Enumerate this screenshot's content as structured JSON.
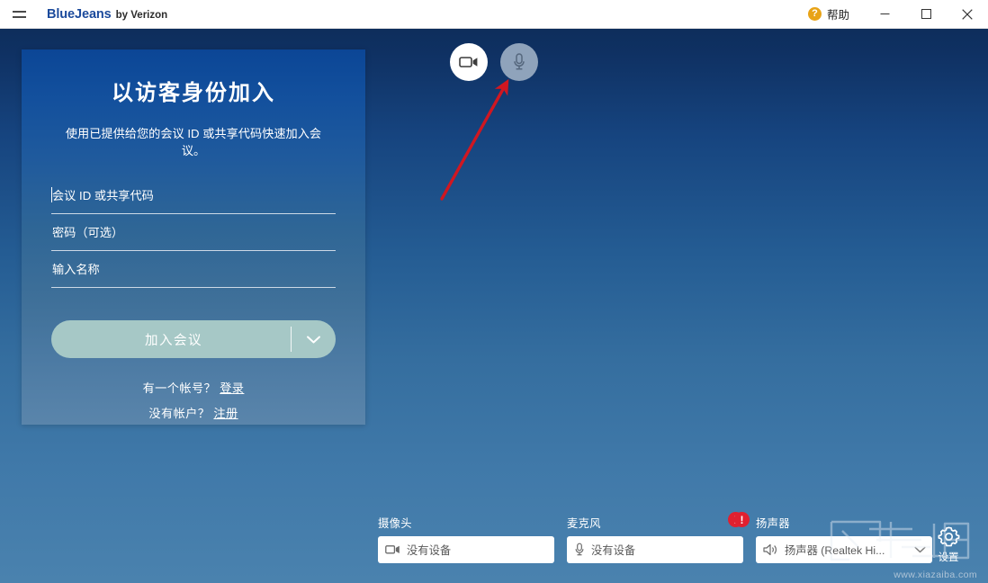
{
  "titlebar": {
    "menu_icon": "hamburger-icon",
    "brand_main": "BlueJeans",
    "brand_sub": "by Verizon",
    "help_icon": "question-mark-icon",
    "help_label": "帮助",
    "minimize_label": "最小化",
    "maximize_label": "最大化",
    "close_label": "关闭"
  },
  "guest_panel": {
    "title": "以访客身份加入",
    "description": "使用已提供给您的会议 ID 或共享代码快速加入会议。",
    "fields": [
      {
        "name": "meeting-id",
        "placeholder": "会议 ID 或共享代码",
        "value": "",
        "focused": true
      },
      {
        "name": "passcode",
        "placeholder": "密码（可选）",
        "value": "",
        "focused": false
      },
      {
        "name": "display-name",
        "placeholder": "输入名称",
        "value": "",
        "focused": false
      }
    ],
    "join_button": {
      "label": "加入会议",
      "color": "#a6c8c6",
      "text_color": "#ffffff",
      "dropdown_icon": "chevron-down-icon"
    },
    "have_account_text": "有一个帐号？",
    "sign_in_link": "登录",
    "no_account_text": "没有帐户？",
    "sign_up_link": "注册"
  },
  "av_toggles": [
    {
      "name": "camera-toggle",
      "icon": "video-camera-icon",
      "state": "on",
      "circle_color": "#ffffff",
      "icon_color": "#3c3c3c"
    },
    {
      "name": "microphone-toggle",
      "icon": "microphone-icon",
      "state": "off",
      "circle_color": "#8fa3bb",
      "icon_color": "#4e5f73"
    }
  ],
  "annotation": {
    "type": "arrow",
    "color": "#d01721",
    "points_at": "microphone-toggle"
  },
  "device_bar": [
    {
      "name": "camera",
      "label": "摄像头",
      "icon": "video-camera-icon",
      "value": "没有设备",
      "has_chevron": false,
      "warning": false
    },
    {
      "name": "microphone",
      "label": "麦克风",
      "icon": "microphone-icon",
      "value": "没有设备",
      "has_chevron": false,
      "warning": true,
      "warning_icon": "exclamation-icon"
    },
    {
      "name": "speaker",
      "label": "扬声器",
      "icon": "speaker-icon",
      "value": "扬声器 (Realtek Hi...",
      "has_chevron": true,
      "warning": true,
      "warning_icon": "exclamation-icon"
    }
  ],
  "settings": {
    "icon": "gear-icon",
    "label": "设置"
  },
  "watermark": {
    "url": "www.xiazaiba.com"
  },
  "colors": {
    "background_top": "#0c2a53",
    "background_bottom": "#4a82ae",
    "panel_top": "#0b4696",
    "panel_bottom": "#5a85ab",
    "brand_blue": "#1b4a9c",
    "warning_red": "#e02030",
    "help_orange": "#e8a317"
  }
}
